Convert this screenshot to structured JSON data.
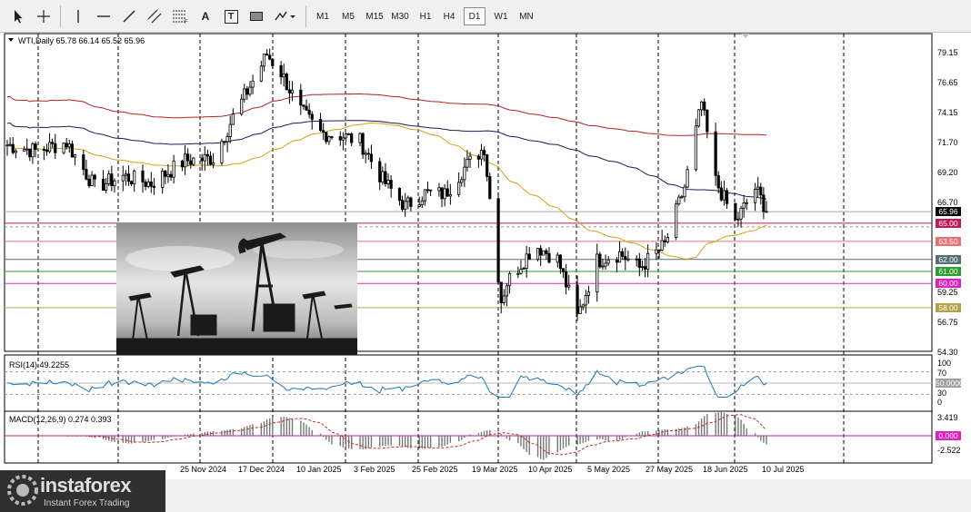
{
  "toolbar": {
    "tools": [
      {
        "icon": "cursor-arrow-icon",
        "label": ""
      },
      {
        "icon": "crosshair-icon",
        "label": ""
      },
      {
        "icon": "vertical-line-icon",
        "label": ""
      },
      {
        "icon": "horizontal-line-icon",
        "label": ""
      },
      {
        "icon": "trend-line-icon",
        "label": ""
      },
      {
        "icon": "equidistant-channel-icon",
        "label": ""
      },
      {
        "icon": "fibonacci-retracement-icon",
        "label": ""
      },
      {
        "icon": "text-icon",
        "label": "A"
      },
      {
        "icon": "text-label-icon",
        "label": "T"
      },
      {
        "icon": "rectangle-icon",
        "label": ""
      },
      {
        "icon": "shapes-dropdown-icon",
        "label": ""
      }
    ],
    "timeframes": [
      "M1",
      "M5",
      "M15",
      "M30",
      "H1",
      "H4",
      "D1",
      "W1",
      "MN"
    ],
    "active_timeframe": "D1"
  },
  "chart": {
    "header": "WTI,Daily  65.78 66.14 65.52 65.96",
    "symbol": "WTI",
    "timeframe": "Daily",
    "ohlc": {
      "open": 65.78,
      "high": 66.14,
      "low": 65.52,
      "close": 65.96
    },
    "price_scale": [
      "79.15",
      "76.65",
      "74.15",
      "71.70",
      "69.20",
      "66.70",
      "59.25",
      "56.75",
      "54.30"
    ],
    "date_labels": [
      "25 Nov 2024",
      "17 Dec 2024",
      "10 Jan 2025",
      "3 Feb 2025",
      "25 Feb 2025",
      "19 Mar 2025",
      "10 Apr 2025",
      "5 May 2025",
      "27 May 2025",
      "18 Jun 2025",
      "10 Jul 2025"
    ],
    "current_price": "65.96",
    "current_price_color": "#000000",
    "levels": [
      {
        "price": 65.0,
        "label": "65.00",
        "color": "#c2185b",
        "style": "solid"
      },
      {
        "price": 63.5,
        "label": "63.50",
        "color": "#e57373",
        "style": "solid"
      },
      {
        "price": 62.0,
        "label": "62.00",
        "color": "#546e7a",
        "style": "solid"
      },
      {
        "price": 61.0,
        "label": "61.00",
        "color": "#2e9e2e",
        "style": "solid"
      },
      {
        "price": 60.0,
        "label": "60.00",
        "color": "#e020c0",
        "style": "solid"
      },
      {
        "price": 58.0,
        "label": "58.00",
        "color": "#b3a246",
        "style": "solid"
      }
    ],
    "ma_colors": {
      "ma200": "#b22222",
      "ma100": "#1a1a5e",
      "ma50": "#d4a017"
    }
  },
  "rsi": {
    "label": "RSI(14) 49.2255",
    "scale": [
      "100",
      "70",
      "50.0000",
      "30",
      "0"
    ],
    "color": "#1f77b4"
  },
  "macd": {
    "label": "MACD(12,26,9) 0.274 0.393",
    "scale": [
      "3.419",
      "0.000",
      "-2.522"
    ],
    "color": "#c62828"
  },
  "watermark": {
    "brand": "instaforex",
    "tagline": "Instant Forex Trading"
  },
  "chart_data": {
    "type": "line",
    "title": "WTI,Daily",
    "series": [
      {
        "name": "WTI",
        "points": [
          [
            "2024-10-15",
            71.5
          ],
          [
            "2024-10-25",
            71.0
          ],
          [
            "2024-11-05",
            71.7
          ],
          [
            "2024-11-15",
            68.0
          ],
          [
            "2024-11-25",
            68.9
          ],
          [
            "2024-12-05",
            68.3
          ],
          [
            "2024-12-17",
            70.2
          ],
          [
            "2024-12-27",
            70.4
          ],
          [
            "2025-01-03",
            73.8
          ],
          [
            "2025-01-10",
            76.8
          ],
          [
            "2025-01-15",
            79.0
          ],
          [
            "2025-01-20",
            77.5
          ],
          [
            "2025-01-27",
            74.3
          ],
          [
            "2025-02-03",
            72.5
          ],
          [
            "2025-02-10",
            72.3
          ],
          [
            "2025-02-17",
            71.8
          ],
          [
            "2025-02-25",
            68.6
          ],
          [
            "2025-03-05",
            66.4
          ],
          [
            "2025-03-12",
            67.5
          ],
          [
            "2025-03-19",
            67.4
          ],
          [
            "2025-03-26",
            69.6
          ],
          [
            "2025-04-02",
            71.3
          ],
          [
            "2025-04-08",
            58.6
          ],
          [
            "2025-04-10",
            60.1
          ],
          [
            "2025-04-20",
            63.2
          ],
          [
            "2025-04-28",
            62.0
          ],
          [
            "2025-05-05",
            57.2
          ],
          [
            "2025-05-12",
            61.9
          ],
          [
            "2025-05-20",
            62.5
          ],
          [
            "2025-05-27",
            61.3
          ],
          [
            "2025-06-05",
            63.2
          ],
          [
            "2025-06-12",
            68.0
          ],
          [
            "2025-06-18",
            75.0
          ],
          [
            "2025-06-23",
            68.5
          ],
          [
            "2025-06-30",
            65.1
          ],
          [
            "2025-07-07",
            67.9
          ],
          [
            "2025-07-10",
            66.6
          ],
          [
            "2025-07-11",
            65.96
          ]
        ]
      },
      {
        "name": "RSI(14)",
        "points": [
          [
            "2025-07-11",
            49.2255
          ]
        ]
      },
      {
        "name": "MACD(12,26,9)",
        "points": [
          [
            "2025-07-11",
            0.274
          ]
        ]
      },
      {
        "name": "Signal",
        "points": [
          [
            "2025-07-11",
            0.393
          ]
        ]
      }
    ],
    "xlabel": "",
    "ylabel": "",
    "ylim": [
      54.3,
      79.15
    ],
    "grid": true
  }
}
